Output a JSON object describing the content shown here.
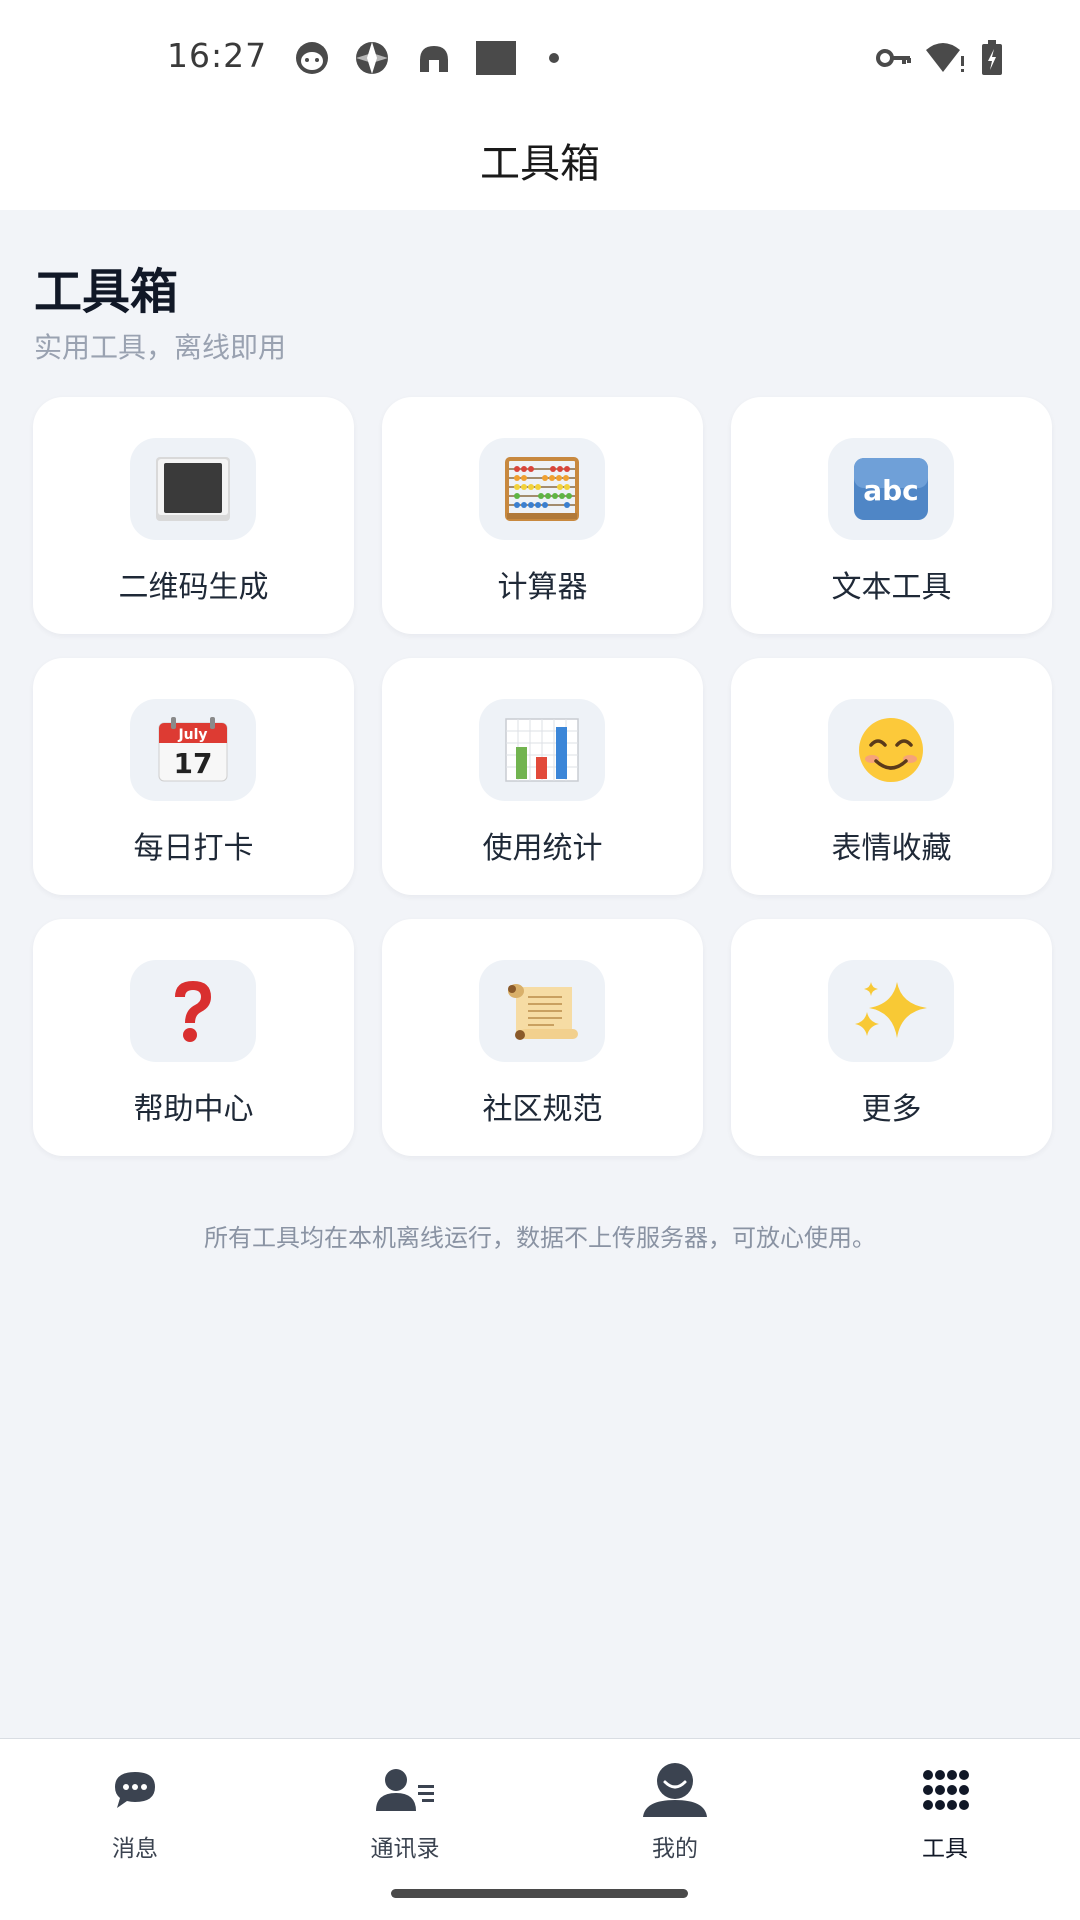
{
  "status_bar": {
    "time": "16:27",
    "icons_left": [
      "cat-face-icon",
      "aperture-icon",
      "android-icon",
      "square-icon",
      "dot-icon"
    ],
    "icons_right": [
      "key-icon",
      "wifi-alert-icon",
      "battery-charging-icon"
    ]
  },
  "title_bar": {
    "title": "工具箱"
  },
  "header": {
    "title": "工具箱",
    "subtitle": "实用工具，离线即用"
  },
  "tools": [
    {
      "label": "二维码生成",
      "icon": "qr-black-square-icon"
    },
    {
      "label": "计算器",
      "icon": "abacus-icon"
    },
    {
      "label": "文本工具",
      "icon": "abc-icon"
    },
    {
      "label": "每日打卡",
      "icon": "calendar-icon"
    },
    {
      "label": "使用统计",
      "icon": "bar-chart-icon"
    },
    {
      "label": "表情收藏",
      "icon": "smiley-icon"
    },
    {
      "label": "帮助中心",
      "icon": "question-mark-icon"
    },
    {
      "label": "社区规范",
      "icon": "scroll-icon"
    },
    {
      "label": "更多",
      "icon": "sparkles-icon"
    }
  ],
  "calendar_icon": {
    "month": "July",
    "day": "17"
  },
  "abc_icon": {
    "text": "abc"
  },
  "footer_note": "所有工具均在本机离线运行，数据不上传服务器，可放心使用。",
  "bottom_nav": [
    {
      "label": "消息",
      "icon": "chat-bubble-icon",
      "active": false
    },
    {
      "label": "通讯录",
      "icon": "contacts-icon",
      "active": false
    },
    {
      "label": "我的",
      "icon": "user-icon",
      "active": false
    },
    {
      "label": "工具",
      "icon": "grid-dots-icon",
      "active": true
    }
  ],
  "colors": {
    "background": "#f2f4f8",
    "card": "#ffffff",
    "icon_box": "#eef2f7",
    "title_text": "#111827",
    "subtitle_text": "#9aa2b1"
  }
}
